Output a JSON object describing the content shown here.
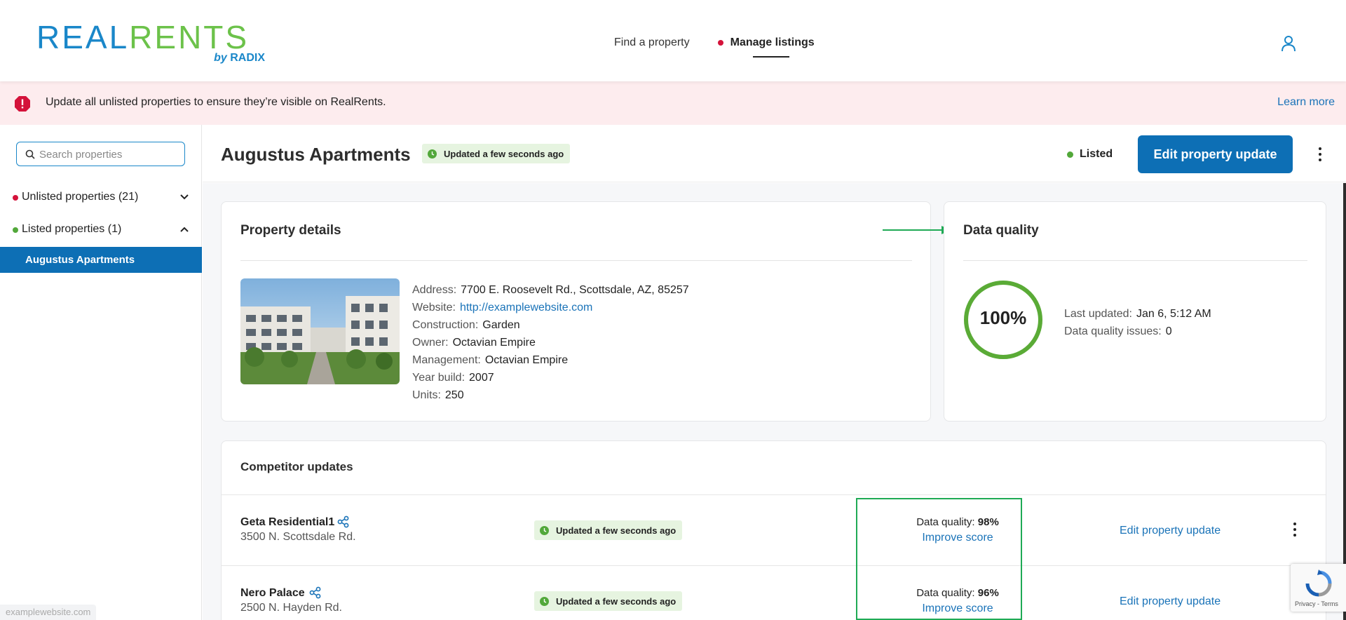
{
  "brand": {
    "logo_left": "REAL",
    "logo_right": "RENTS",
    "logo_sub_by": "by",
    "logo_sub_name": "RADIX"
  },
  "nav": {
    "find": "Find a property",
    "manage": "Manage listings"
  },
  "banner": {
    "text": "Update all unlisted properties to ensure they’re visible on RealRents.",
    "link": "Learn more"
  },
  "sidebar": {
    "search_placeholder": "Search properties",
    "groups": [
      {
        "label": "Unlisted properties (21)",
        "dot_color": "#d4123a",
        "expanded": false
      },
      {
        "label": "Listed properties (1)",
        "dot_color": "#52a83a",
        "expanded": true
      }
    ],
    "active_item": "Augustus Apartments"
  },
  "property": {
    "title": "Augustus Apartments",
    "updated_badge": "Updated a few seconds ago",
    "status": "Listed",
    "edit_button": "Edit property update"
  },
  "details_card": {
    "title": "Property details",
    "rows": [
      {
        "key": "Address:",
        "value": "7700 E. Roosevelt Rd., Scottsdale, AZ, 85257"
      },
      {
        "key": "Website:",
        "value": "http://examplewebsite.com",
        "link": true
      },
      {
        "key": "Construction:",
        "value": "Garden"
      },
      {
        "key": "Owner:",
        "value": "Octavian Empire"
      },
      {
        "key": "Management:",
        "value": "Octavian Empire"
      },
      {
        "key": "Year build:",
        "value": "2007"
      },
      {
        "key": "Units:",
        "value": "250"
      }
    ]
  },
  "quality_card": {
    "title": "Data quality",
    "score": "100%",
    "score_fraction": 1.0,
    "last_updated_key": "Last updated:",
    "last_updated_value": "Jan 6, 5:12 AM",
    "issues_key": "Data quality issues:",
    "issues_value": "0",
    "ring_color": "#5aab36"
  },
  "competitors": {
    "title": "Competitor updates",
    "rows": [
      {
        "name": "Geta Residential1",
        "address": "3500 N. Scottsdale Rd.",
        "badge": "Updated a few seconds ago",
        "dq_label": "Data quality:",
        "dq_value": "98%",
        "improve": "Improve score",
        "edit": "Edit property update"
      },
      {
        "name": "Nero Palace",
        "address": "2500 N. Hayden Rd.",
        "badge": "Updated a few seconds ago",
        "dq_label": "Data quality:",
        "dq_value": "96%",
        "improve": "Improve score",
        "edit": "Edit property update"
      }
    ]
  },
  "status_bar": {
    "url": "examplewebsite.com"
  },
  "recaptcha": {
    "terms": "Privacy - Terms"
  },
  "colors": {
    "primary": "#0d6fb5",
    "brand_blue": "#1a87c9",
    "brand_green": "#6cc24a",
    "alert_red": "#d4123a",
    "success_green": "#52a83a"
  }
}
